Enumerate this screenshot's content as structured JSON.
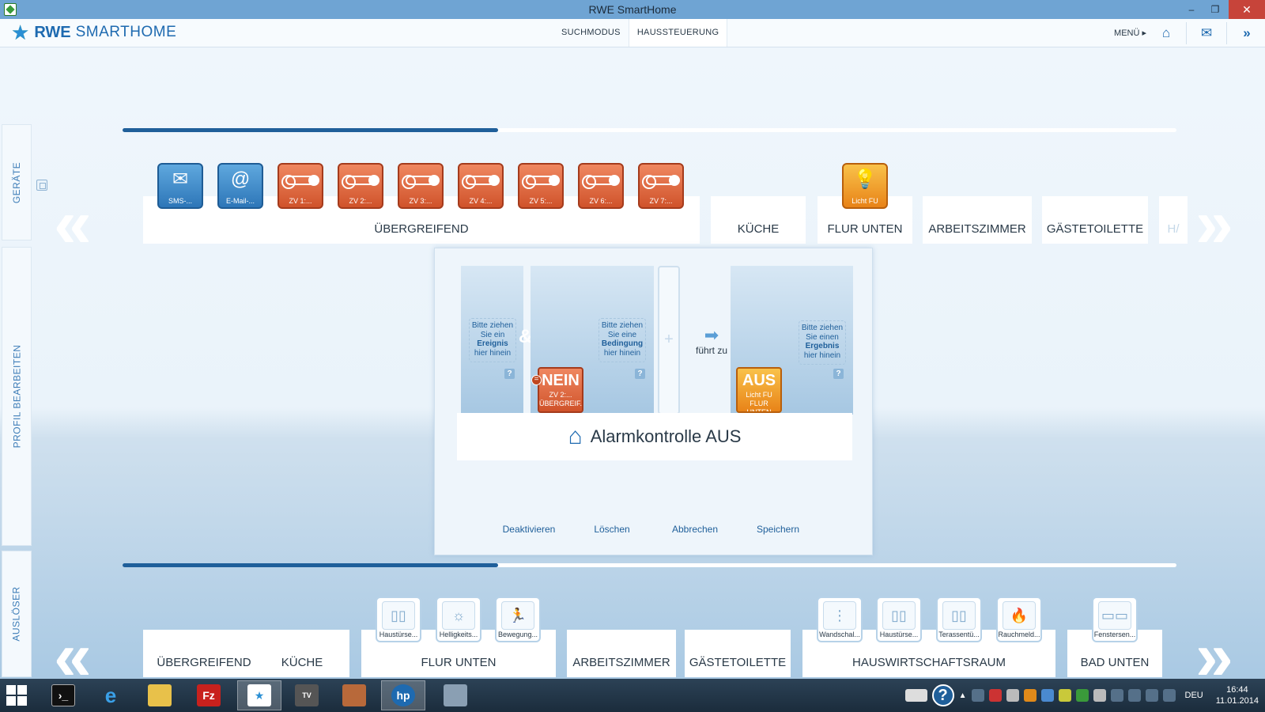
{
  "window": {
    "title": "RWE SmartHome",
    "minimize": "–",
    "maximize": "❐",
    "close": "✕"
  },
  "header": {
    "logo_brand": "RWE",
    "logo_product": "SMARTHOME",
    "tabs": [
      {
        "label": "SUCHMODUS"
      },
      {
        "label": "HAUSSTEUERUNG"
      }
    ],
    "menu_label": "MENÜ ▸"
  },
  "sidebar": {
    "geraete": "GERÄTE",
    "profil": "PROFIL BEARBEITEN",
    "ausloeser": "AUSLÖSER"
  },
  "top_progress": 0.356,
  "bottom_progress": 0.356,
  "devices_top": [
    {
      "label": "SMS-...",
      "color": "blue",
      "icon": "sms-icon"
    },
    {
      "label": "E-Mail-...",
      "color": "blue",
      "icon": "at-icon"
    },
    {
      "label": "ZV 1:...",
      "color": "orange",
      "icon": "zv-icon"
    },
    {
      "label": "ZV 2:...",
      "color": "orange",
      "icon": "zv-icon"
    },
    {
      "label": "ZV 3:...",
      "color": "orange",
      "icon": "zv-icon"
    },
    {
      "label": "ZV 4:...",
      "color": "orange",
      "icon": "zv-icon"
    },
    {
      "label": "ZV 5:...",
      "color": "orange",
      "icon": "zv-icon"
    },
    {
      "label": "ZV 6:...",
      "color": "orange",
      "icon": "zv-icon"
    },
    {
      "label": "ZV 7:...",
      "color": "orange",
      "icon": "zv-icon"
    },
    {
      "label": "Licht FU",
      "color": "yellow",
      "icon": "bulb-icon"
    }
  ],
  "rooms_top": [
    "ÜBERGREIFEND",
    "KÜCHE",
    "FLUR UNTEN",
    "ARBEITSZIMMER",
    "GÄSTETOILETTE",
    "H/"
  ],
  "editor": {
    "slot_event": {
      "l1": "Bitte ziehen",
      "l2": "Sie ein",
      "l3": "Ereignis",
      "l4": "hier hinein"
    },
    "slot_condition": {
      "l1": "Bitte ziehen",
      "l2": "Sie eine",
      "l3": "Bedingung",
      "l4": "hier hinein"
    },
    "slot_result": {
      "l1": "Bitte ziehen",
      "l2": "Sie einen",
      "l3": "Ergebnis",
      "l4": "hier hinein"
    },
    "amp": "&",
    "plus": "+",
    "leads_to": "führt zu",
    "condition_card": {
      "state": "NEIN",
      "line1": "ZV 2:...",
      "line2": "ÜBERGREIF..."
    },
    "result_card": {
      "state": "AUS",
      "line1": "Licht FU",
      "line2": "FLUR UNTEN"
    },
    "profile_name": "Alarmkontrolle AUS",
    "qmark": "?",
    "actions": [
      "Deaktivieren",
      "Löschen",
      "Abbrechen",
      "Speichern"
    ]
  },
  "triggers_bottom": [
    {
      "label": "Haustürse...",
      "icon": "door-sensor-icon"
    },
    {
      "label": "Helligkeits...",
      "icon": "brightness-sensor-icon"
    },
    {
      "label": "Bewegung...",
      "icon": "motion-sensor-icon"
    },
    {
      "label": "Wandschal...",
      "icon": "wall-switch-icon"
    },
    {
      "label": "Haustürse...",
      "icon": "door-sensor-icon"
    },
    {
      "label": "Terassentü...",
      "icon": "door-sensor-icon"
    },
    {
      "label": "Rauchmeld...",
      "icon": "smoke-detector-icon"
    },
    {
      "label": "Fenstersen...",
      "icon": "window-sensor-icon"
    }
  ],
  "rooms_bottom": [
    "ÜBERGREIFEND",
    "KÜCHE",
    "FLUR UNTEN",
    "ARBEITSZIMMER",
    "GÄSTETOILETTE",
    "HAUSWIRTSCHAFTSRAUM",
    "BAD UNTEN"
  ],
  "taskbar": {
    "lang": "DEU",
    "time": "16:44",
    "date": "11.01.2014"
  }
}
